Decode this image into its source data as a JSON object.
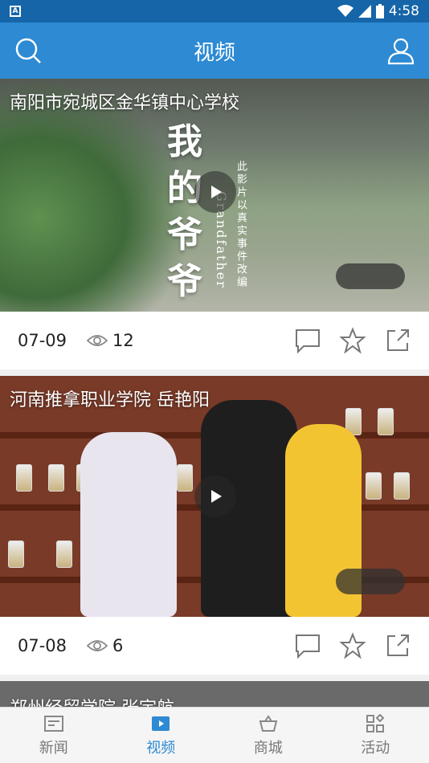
{
  "status_bar": {
    "time": "4:58",
    "app_badge": "A"
  },
  "app_bar": {
    "title": "视频"
  },
  "videos": [
    {
      "title": "南阳市宛城区金华镇中心学校",
      "date": "07-09",
      "views": "12",
      "poster_chars": [
        "我",
        "的",
        "爷",
        "爷"
      ],
      "poster_en": "Grandfather",
      "poster_note": "此影片以真实事件改编"
    },
    {
      "title": "河南推拿职业学院 岳艳阳",
      "date": "07-08",
      "views": "6"
    },
    {
      "title": "郑州经贸学院 张宇航"
    }
  ],
  "bottom_nav": [
    {
      "label": "新闻",
      "icon": "news-icon"
    },
    {
      "label": "视频",
      "icon": "video-icon",
      "active": true
    },
    {
      "label": "商城",
      "icon": "shop-icon"
    },
    {
      "label": "活动",
      "icon": "activity-icon"
    }
  ],
  "colors": {
    "primary": "#2d8ad3",
    "status_bar": "#1565a8"
  }
}
